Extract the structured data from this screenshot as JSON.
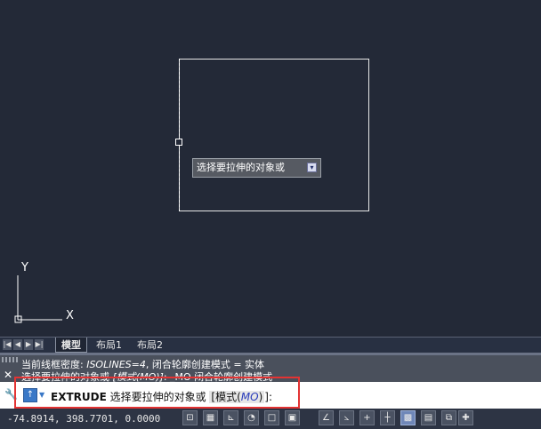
{
  "canvas": {
    "ucs": {
      "y_label": "Y",
      "x_label": "X"
    },
    "tooltip": {
      "text": "选择要拉伸的对象或",
      "dropdown_glyph": "▾"
    }
  },
  "layout_tabs": {
    "nav_buttons": [
      "|◀",
      "◀",
      "▶",
      "▶|"
    ],
    "tabs": [
      {
        "label": "模型",
        "active": true
      },
      {
        "label": "布局1",
        "active": false
      },
      {
        "label": "布局2",
        "active": false
      }
    ]
  },
  "history": {
    "line1": {
      "prefix": "当前线框密度: ",
      "italic": "ISOLINES=4",
      "suffix": ", 闭合轮廓创建模式 = 实体"
    },
    "line2": {
      "prefix": "选择要拉伸的对象或 ",
      "italic": "[模式(MO)]",
      "suffix": ": _MO 闭合轮廓创建模式"
    },
    "close_glyph": "✕"
  },
  "command_line": {
    "command": "EXTRUDE",
    "prompt": " 选择要拉伸的对象或 ",
    "bracket_open": "[",
    "option": "模式(",
    "option_key": "MO",
    "option_close": ")",
    "bracket_close": "]:"
  },
  "status_bar": {
    "coordinates": "-74.8914, 398.7701, 0.0000",
    "buttons": [
      {
        "name": "snap-mode",
        "glyph": "⊡",
        "on": false
      },
      {
        "name": "grid-display",
        "glyph": "▦",
        "on": false
      },
      {
        "name": "ortho-mode",
        "glyph": "⊾",
        "on": false
      },
      {
        "name": "polar-tracking",
        "glyph": "◔",
        "on": false
      },
      {
        "name": "object-snap",
        "glyph": "□",
        "on": false
      },
      {
        "name": "3d-object-snap",
        "glyph": "▣",
        "on": false
      },
      {
        "name": "object-snap-tracking",
        "glyph": "∠",
        "on": false
      },
      {
        "name": "dynamic-ucs",
        "glyph": "⦣",
        "on": false
      },
      {
        "name": "dynamic-input",
        "glyph": "+",
        "on": false
      },
      {
        "name": "lineweight",
        "glyph": "┼",
        "on": false
      },
      {
        "name": "transparency",
        "glyph": "▩",
        "on": true
      },
      {
        "name": "quick-properties",
        "glyph": "▤",
        "on": false
      },
      {
        "name": "selection-cycling",
        "glyph": "⧉",
        "on": false
      },
      {
        "name": "annotation-monitor",
        "glyph": "✚",
        "on": false
      }
    ]
  }
}
